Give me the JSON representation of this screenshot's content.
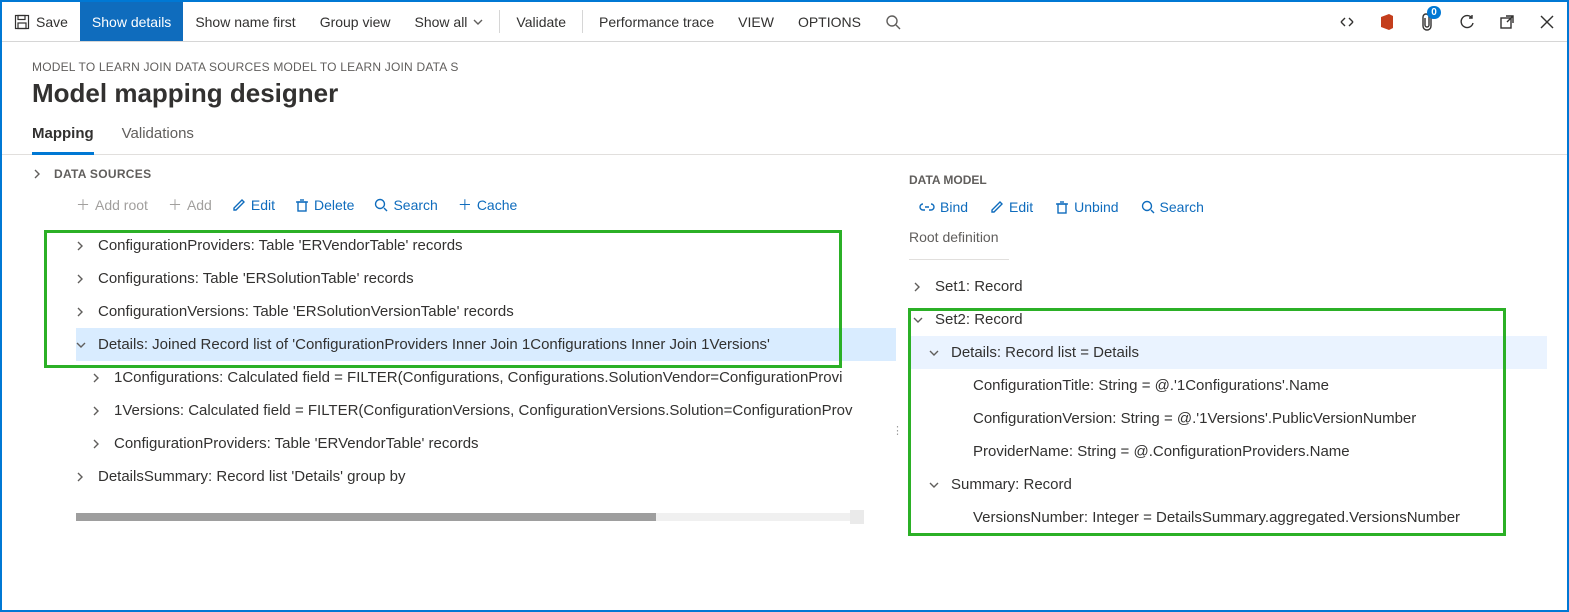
{
  "toolbar": {
    "save": "Save",
    "show_details": "Show details",
    "show_name_first": "Show name first",
    "group_view": "Group view",
    "show_all": "Show all",
    "validate": "Validate",
    "perf_trace": "Performance trace",
    "view": "VIEW",
    "options": "OPTIONS",
    "badge_count": "0"
  },
  "header": {
    "breadcrumb": "MODEL TO LEARN JOIN DATA SOURCES MODEL TO LEARN JOIN DATA S",
    "title": "Model mapping designer"
  },
  "tabs": {
    "mapping": "Mapping",
    "validations": "Validations"
  },
  "left": {
    "panel_title": "DATA SOURCES",
    "actions": {
      "add_root": "Add root",
      "add": "Add",
      "edit": "Edit",
      "delete": "Delete",
      "search": "Search",
      "cache": "Cache"
    },
    "nodes": [
      "ConfigurationProviders: Table 'ERVendorTable' records",
      "Configurations: Table 'ERSolutionTable' records",
      "ConfigurationVersions: Table 'ERSolutionVersionTable' records",
      "Details: Joined Record list of 'ConfigurationProviders Inner Join 1Configurations Inner Join 1Versions'",
      "1Configurations: Calculated field = FILTER(Configurations, Configurations.SolutionVendor=ConfigurationProvi",
      "1Versions: Calculated field = FILTER(ConfigurationVersions, ConfigurationVersions.Solution=ConfigurationProv",
      "ConfigurationProviders: Table 'ERVendorTable' records",
      "DetailsSummary: Record list 'Details' group by"
    ]
  },
  "right": {
    "panel_title": "DATA MODEL",
    "actions": {
      "bind": "Bind",
      "edit": "Edit",
      "unbind": "Unbind",
      "search": "Search"
    },
    "root_def_label": "Root definition",
    "nodes": [
      "Set1: Record",
      "Set2: Record",
      "Details: Record list = Details",
      "ConfigurationTitle: String = @.'1Configurations'.Name",
      "ConfigurationVersion: String = @.'1Versions'.PublicVersionNumber",
      "ProviderName: String = @.ConfigurationProviders.Name",
      "Summary: Record",
      "VersionsNumber: Integer = DetailsSummary.aggregated.VersionsNumber"
    ]
  }
}
